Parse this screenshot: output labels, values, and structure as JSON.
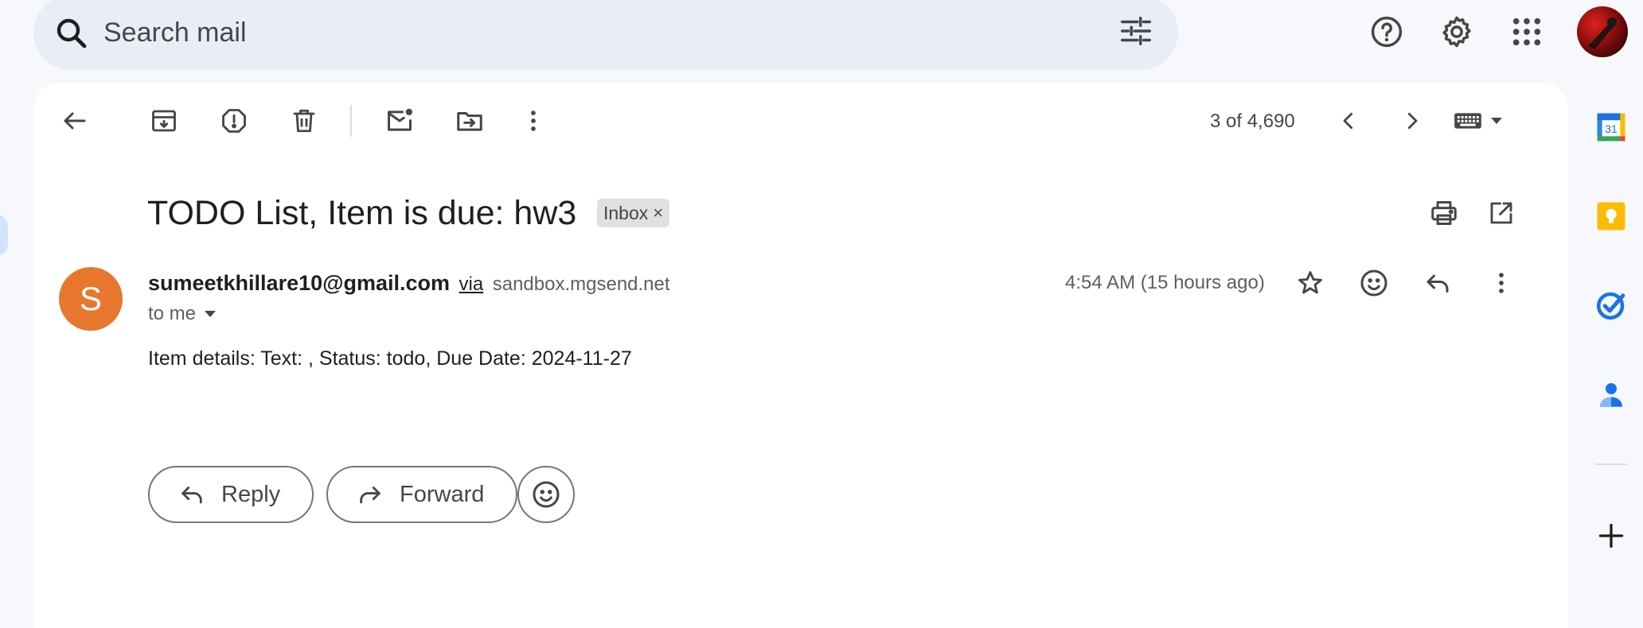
{
  "search": {
    "placeholder": "Search mail"
  },
  "icons": {
    "search": "search-icon",
    "filter": "tune-icon",
    "help": "help-icon",
    "settings": "gear-icon",
    "apps": "apps-grid-icon"
  },
  "toolbar": {
    "pager_text": "3 of 4,690"
  },
  "email": {
    "subject": "TODO List, Item is due: hw3",
    "label_chip": "Inbox",
    "label_chip_remove": "×",
    "sender_initial": "S",
    "sender_email": "sumeetkhillare10@gmail.com",
    "via_text": "via",
    "via_domain": "sandbox.mgsend.net",
    "recipient": "to me",
    "timestamp": "4:54 AM (15 hours ago)",
    "body": "Item details: Text: , Status: todo, Due Date: 2024-11-27"
  },
  "actions": {
    "reply_label": "Reply",
    "forward_label": "Forward"
  },
  "side_panel": {
    "calendar_day": "31"
  },
  "colors": {
    "avatar": "#e8772e",
    "search_bg": "#e9eef6",
    "page_bg": "#f6f8fc",
    "keep": "#fbbc04",
    "tasks": "#1a73e8",
    "contacts": "#1a73e8"
  }
}
